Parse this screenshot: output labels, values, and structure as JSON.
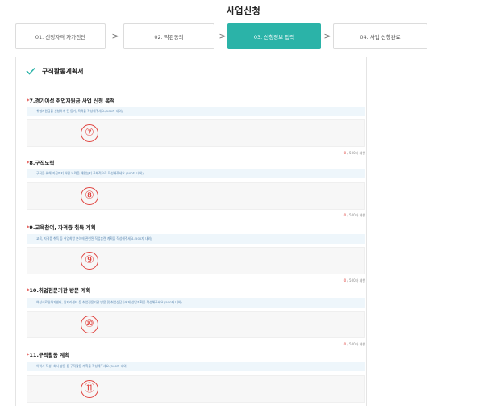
{
  "page": {
    "title": "사업신청"
  },
  "steps": [
    {
      "label": "01. 신청자격 자가진단",
      "active": false
    },
    {
      "label": "02. 약관동의",
      "active": false
    },
    {
      "label": "03. 신청정보 입력",
      "active": true
    },
    {
      "label": "04. 사업 신청완료",
      "active": false
    }
  ],
  "step_arrow": ">",
  "panel": {
    "heading": "구직활동계획서"
  },
  "sections": [
    {
      "marker": "*",
      "title": "7.경기여성 취업지원금 사업 신청 목적",
      "hint": "취업지원금을 신청하게 된 동기, 목적을 작성해주세요.(500자 내외)",
      "circle": "⑦",
      "count": "0",
      "limit": " / 500자 제한"
    },
    {
      "marker": "*",
      "title": "8.구직노력",
      "hint": "구직을 위해 지금까지 어떤 노력을 해왔는지 구체적으로 작성해주세요.(500자 내외)",
      "circle": "⑧",
      "count": "0",
      "limit": " / 500자 제한"
    },
    {
      "marker": "*",
      "title": "9.교육참여, 자격증 취득 계획",
      "hint": "교육, 자격증 취득 등 취업희망 분야에 관련된 직업훈련 계획을 작성해주세요.(500자 내외)",
      "circle": "⑨",
      "count": "0",
      "limit": " / 500자 제한"
    },
    {
      "marker": "*",
      "title": "10.취업전문기관 방문 계획",
      "hint": "여성새로일하기센터, 일자리센터 등 취업전문기관 방문 및 취업상담사에게 상담계획을 작성해주세요.(500자 내외)",
      "circle": "⑩",
      "count": "0",
      "limit": " / 500자 제한"
    },
    {
      "marker": "*",
      "title": "11.구직활동 계획",
      "hint": "이력서 작성, 회사 방문 등 구직활동 계획을 작성해주세요.(500자 내외)",
      "circle": "⑪"
    }
  ],
  "colors": {
    "accent": "#2bb3a8",
    "required": "#e0413d",
    "hint_bg": "#eef6fb"
  }
}
